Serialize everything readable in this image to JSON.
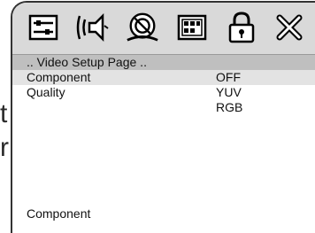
{
  "background_text": {
    "left_glyph_1": "t",
    "left_glyph_2": "r"
  },
  "toolbar": {
    "icons": [
      "general-setup-icon",
      "audio-setup-icon",
      "dolby-setup-icon",
      "video-setup-icon",
      "lock-icon",
      "exit-icon"
    ]
  },
  "page": {
    "title": ".. Video Setup Page .."
  },
  "settings": [
    {
      "label": "Component",
      "selected": true
    },
    {
      "label": "Quality",
      "selected": false
    }
  ],
  "options": [
    {
      "label": "OFF",
      "active": true
    },
    {
      "label": "YUV",
      "active": false
    },
    {
      "label": "RGB",
      "active": false
    }
  ],
  "status": {
    "text": "Component"
  },
  "colors": {
    "toolbar_bg": "#d9d9d9",
    "header_bg": "#bfbfbf",
    "highlight_bg": "#e3e3e3"
  }
}
